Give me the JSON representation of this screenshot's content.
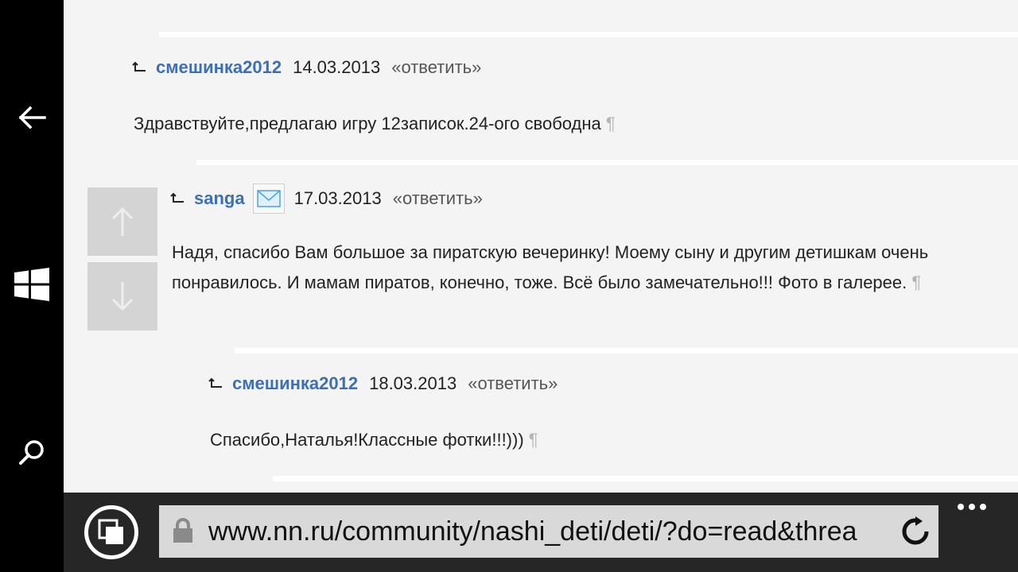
{
  "system_bar": {
    "back": "back-arrow-icon",
    "start": "windows-logo-icon",
    "search": "search-icon"
  },
  "comments": [
    {
      "author": "смешинка2012",
      "date": "14.03.2013",
      "reply": "«ответить»",
      "text": "Здравствуйте,предлагаю игру 12записок.24-ого свободна",
      "pilcrow": "¶"
    },
    {
      "author": "sanga",
      "date": "17.03.2013",
      "reply": "«ответить»",
      "text": "Надя, спасибо Вам большое за пиратскую вечеринку! Моему сыну и другим детишкам очень понравилось. И мамам пиратов, конечно, тоже. Всё было замечательно!!! Фото в галерее.",
      "pilcrow": "¶"
    },
    {
      "author": "смешинка2012",
      "date": "18.03.2013",
      "reply": "«ответить»",
      "text": "Спасибо,Наталья!Классные фотки!!!)))",
      "pilcrow": "¶"
    }
  ],
  "address_bar": {
    "url": "www.nn.ru/community/nashi_deti/deti/?do=read&threa"
  },
  "colors": {
    "author_link": "#3d6fb4",
    "page_bg": "#f4f4f4",
    "appbar_bg": "#262626",
    "url_box_bg": "#d9d9d9"
  }
}
